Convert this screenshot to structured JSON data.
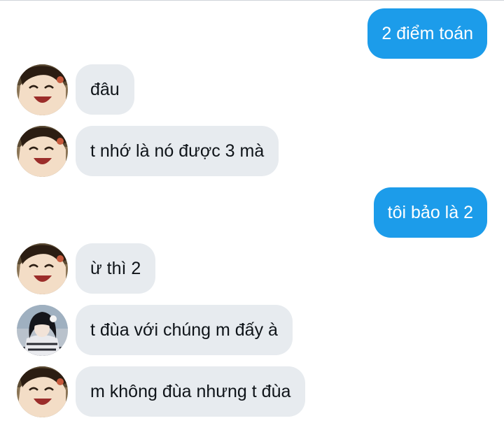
{
  "conversation": {
    "messages": [
      {
        "direction": "outgoing",
        "text": "2 điểm toán"
      },
      {
        "direction": "incoming",
        "avatar": "avatar-boy-laughing",
        "text": "đâu"
      },
      {
        "direction": "incoming",
        "avatar": "avatar-boy-laughing",
        "text": "t nhớ là nó được 3 mà"
      },
      {
        "direction": "outgoing",
        "text": "tôi bảo là 2"
      },
      {
        "direction": "incoming",
        "avatar": "avatar-boy-laughing",
        "text": "ừ thì 2"
      },
      {
        "direction": "incoming",
        "avatar": "avatar-dark-hair-character",
        "text": "t đùa với chúng m đấy à"
      },
      {
        "direction": "incoming",
        "avatar": "avatar-boy-laughing",
        "text": "m không đùa nhưng t đùa"
      }
    ]
  },
  "colors": {
    "outgoing_bubble": "#1c9cea",
    "incoming_bubble": "#e7ebef",
    "outgoing_text": "#ffffff",
    "incoming_text": "#0f1419"
  }
}
